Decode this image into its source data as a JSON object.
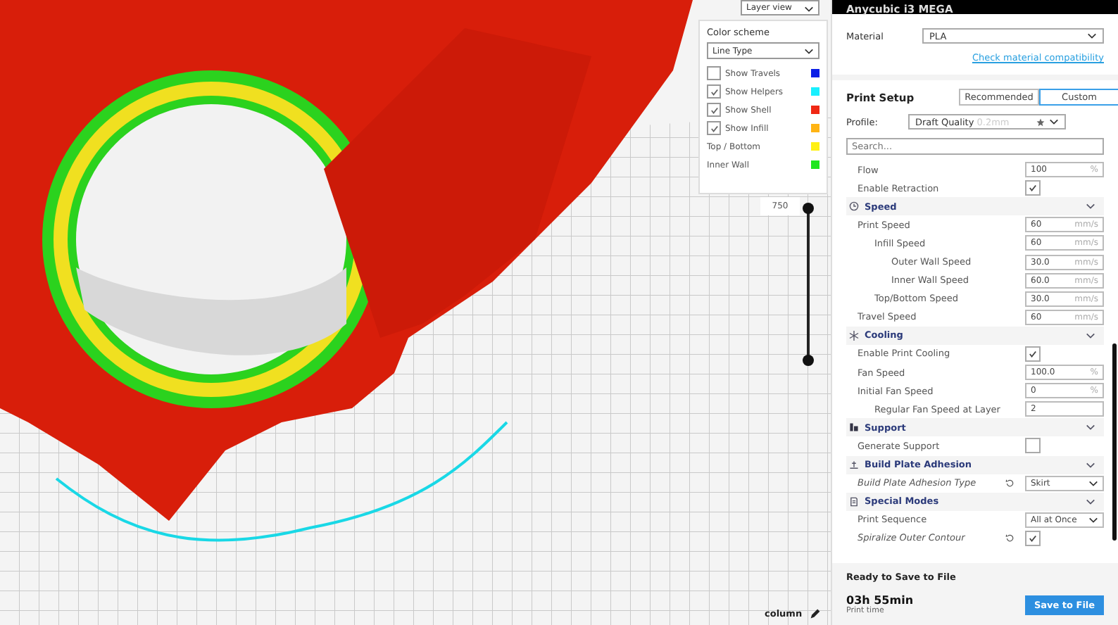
{
  "viewport": {
    "view_mode": "Layer view",
    "color_scheme": {
      "title": "Color scheme",
      "dropdown": "Line Type",
      "legend": [
        {
          "kind": "checkbox",
          "label": "Show Travels",
          "checked": false,
          "color": "#0a1ee6"
        },
        {
          "kind": "checkbox",
          "label": "Show Helpers",
          "checked": true,
          "color": "#19f0ff"
        },
        {
          "kind": "checkbox",
          "label": "Show Shell",
          "checked": true,
          "color": "#f02814"
        },
        {
          "kind": "checkbox",
          "label": "Show Infill",
          "checked": true,
          "color": "#ffb414"
        },
        {
          "kind": "plain",
          "label": "Top / Bottom",
          "color": "#fff014"
        },
        {
          "kind": "plain",
          "label": "Inner Wall",
          "color": "#1ee61e"
        }
      ]
    },
    "layer": "750",
    "layer_slider": {
      "level": 1
    },
    "object_name": "column"
  },
  "panel": {
    "printer": "Anycubic i3 MEGA",
    "material": {
      "label": "Material",
      "value": "PLA"
    },
    "link": "Check material compatibility",
    "print_setup": {
      "title": "Print Setup",
      "modes": [
        {
          "label": "Recommended",
          "selected": false
        },
        {
          "label": "Custom",
          "selected": true
        }
      ],
      "profile": {
        "label": "Profile:",
        "value": "Draft Quality",
        "hint": "0.2mm"
      },
      "search": {
        "placeholder": "Search..."
      }
    },
    "settings": [
      {
        "kind": "field",
        "label": "Flow",
        "value": "100",
        "unit": "%"
      },
      {
        "kind": "checkbox",
        "label": "Enable Retraction",
        "checked": true
      },
      {
        "kind": "category",
        "label": "Speed",
        "children": [
          {
            "kind": "field",
            "label": "Print Speed",
            "value": "60",
            "unit": "mm/s",
            "children": [
              {
                "kind": "field",
                "label": "Infill Speed",
                "value": "60",
                "unit": "mm/s",
                "children": [
                  {
                    "kind": "field",
                    "label": "Outer Wall Speed",
                    "value": "30.0",
                    "unit": "mm/s"
                  },
                  {
                    "kind": "field",
                    "label": "Inner Wall Speed",
                    "value": "60.0",
                    "unit": "mm/s"
                  }
                ]
              },
              {
                "kind": "field",
                "label": "Top/Bottom Speed",
                "value": "30.0",
                "unit": "mm/s"
              }
            ]
          },
          {
            "kind": "field",
            "label": "Travel Speed",
            "value": "60",
            "unit": "mm/s"
          }
        ]
      },
      {
        "kind": "category",
        "label": "Cooling",
        "children": [
          {
            "kind": "checkbox",
            "label": "Enable Print Cooling",
            "checked": true
          },
          {
            "kind": "field",
            "label": "Fan Speed",
            "value": "100.0",
            "unit": "%"
          },
          {
            "kind": "field",
            "label": "Initial Fan Speed",
            "value": "0",
            "unit": "%",
            "children": [
              {
                "kind": "field",
                "label": "Regular Fan Speed at Layer",
                "value": "2"
              }
            ]
          }
        ]
      },
      {
        "kind": "category",
        "label": "Support",
        "children": [
          {
            "kind": "checkbox",
            "label": "Generate Support",
            "checked": false
          }
        ]
      },
      {
        "kind": "category",
        "label": "Build Plate Adhesion",
        "children": [
          {
            "kind": "select",
            "label": "Build Plate Adhesion Type",
            "value": "Skirt",
            "reset": true
          }
        ]
      },
      {
        "kind": "category",
        "label": "Special Modes",
        "children": [
          {
            "kind": "select",
            "label": "Print Sequence",
            "value": "All at Once"
          },
          {
            "kind": "checkbox",
            "label": "Spiralize Outer Contour",
            "checked": true,
            "reset": true
          }
        ]
      }
    ],
    "footer": {
      "status": "Ready to Save to File",
      "time": "03h 55min",
      "time_label": "Print time",
      "button": "Save to File"
    }
  }
}
